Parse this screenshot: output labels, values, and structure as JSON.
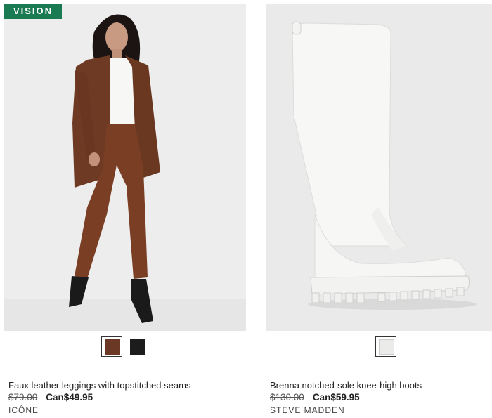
{
  "products": [
    {
      "badge": "VISION",
      "name": "Faux leather leggings with topstitched seams",
      "old_price": "$79.00",
      "sale_price": "Can$49.95",
      "brand": "ICÔNE",
      "swatches": [
        {
          "color": "#6b3826",
          "selected": true
        },
        {
          "color": "#1c1c1c",
          "selected": false
        }
      ]
    },
    {
      "name": "Brenna notched-sole knee-high boots",
      "old_price": "$130.00",
      "sale_price": "Can$59.95",
      "brand": "STEVE MADDEN",
      "swatches": [
        {
          "color": "#ebebea",
          "selected": true
        }
      ]
    }
  ]
}
